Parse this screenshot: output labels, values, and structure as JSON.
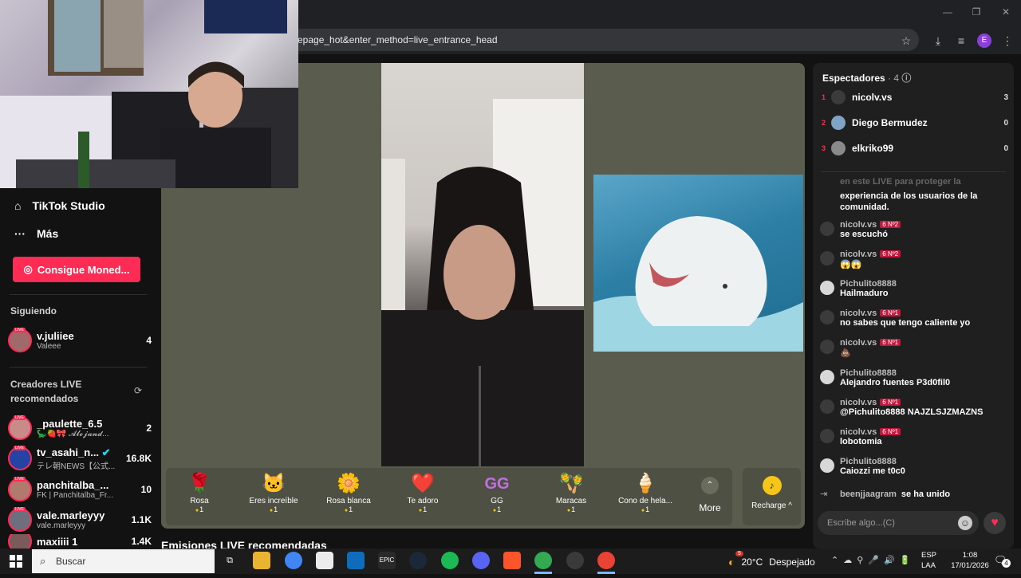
{
  "browser": {
    "url": "epage_hot&enter_method=live_entrance_head",
    "profile_initial": "E"
  },
  "sidebar": {
    "studio_label": "TikTok Studio",
    "more_label": "Más",
    "coins_button": "Consigue Moned...",
    "following_heading": "Siguiendo",
    "following": [
      {
        "name": "v.juliiee",
        "sub": "Valeee",
        "count": "4"
      }
    ],
    "recommended_heading": "Creadores LIVE recomendados",
    "recommended": [
      {
        "name": "_paulette_6.5",
        "sub": "🦕🍓🎀 𝓐𝓵𝓮𝓳𝓪𝓷𝓭...",
        "count": "2"
      },
      {
        "name": "tv_asahi_n...",
        "sub": "テレ朝NEWS【公式...",
        "count": "16.8K"
      },
      {
        "name": "panchitalba_...",
        "sub": "FK | Panchitalba_Fr...",
        "count": "10"
      },
      {
        "name": "vale.marleyyy",
        "sub": "vale.marleyyy",
        "count": "1.1K"
      },
      {
        "name": "maxiiii 1",
        "sub": "",
        "count": "1.4K"
      }
    ],
    "live_badge": "LIVE"
  },
  "stream": {
    "gifts": [
      {
        "icon": "🌹",
        "name": "Rosa",
        "price": "1"
      },
      {
        "icon": "🐱",
        "name": "Eres increíble",
        "price": "1"
      },
      {
        "icon": "🌼",
        "name": "Rosa blanca",
        "price": "1"
      },
      {
        "icon": "❤️",
        "name": "Te adoro",
        "price": "1"
      },
      {
        "icon": "GG",
        "name": "GG",
        "price": "1"
      },
      {
        "icon": "🪇",
        "name": "Maracas",
        "price": "1"
      },
      {
        "icon": "🍦",
        "name": "Cono de hela...",
        "price": "1"
      }
    ],
    "more_label": "More",
    "recharge_label": "Recharge ^",
    "recommended_title": "Emisiones LIVE recomendadas"
  },
  "chat": {
    "viewers_title": "Espectadores",
    "viewers_count": "· 4",
    "viewers": [
      {
        "rank": "1",
        "name": "nicolv.vs",
        "score": "3"
      },
      {
        "rank": "2",
        "name": "Diego Bermudez",
        "score": "0"
      },
      {
        "rank": "3",
        "name": "elkriko99",
        "score": "0"
      }
    ],
    "partial_notice_top": "en este LIVE para proteger la",
    "partial_notice": "experiencia de los usuarios de la comunidad.",
    "messages": [
      {
        "user": "nicolv.vs",
        "badge": "6 Nº2",
        "text": "se escuchó"
      },
      {
        "user": "nicolv.vs",
        "badge": "6 Nº2",
        "text": "😱😱"
      },
      {
        "user": "Pichulito8888",
        "badge": "",
        "text": "Hailmaduro"
      },
      {
        "user": "nicolv.vs",
        "badge": "6 Nº1",
        "text": "no sabes que tengo caliente yo"
      },
      {
        "user": "nicolv.vs",
        "badge": "6 Nº1",
        "text": "💩"
      },
      {
        "user": "Pichulito8888",
        "badge": "",
        "text": "Alejandro fuentes P3d0fil0"
      },
      {
        "user": "nicolv.vs",
        "badge": "6 Nº1",
        "text": "@Pichulito8888 NAJZLSJZMAZNS"
      },
      {
        "user": "nicolv.vs",
        "badge": "6 Nº1",
        "text": "lobotomia"
      },
      {
        "user": "Pichulito8888",
        "badge": "",
        "text": "Caiozzi me t0c0"
      }
    ],
    "join_user": "beenjjaagram",
    "join_text": "se ha unido",
    "input_placeholder": "Escribe algo...(C)"
  },
  "taskbar": {
    "search_placeholder": "Buscar",
    "weather_badge": "5",
    "temperature": "20°C",
    "weather_text": "Despejado",
    "lang_top": "ESP",
    "lang_bottom": "LAA",
    "time": "1:08",
    "date": "17/01/2026",
    "notif_count": "4"
  },
  "colors": {
    "accent": "#fe2c55",
    "stream_bg": "#5a5c4d",
    "coin": "#f5c518"
  }
}
